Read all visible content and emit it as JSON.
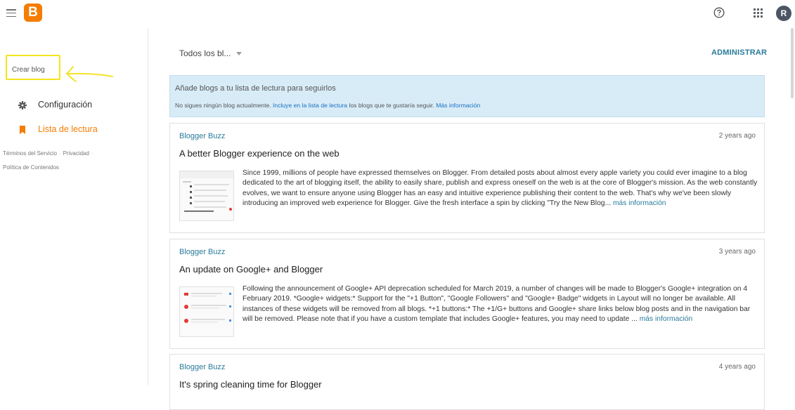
{
  "header": {
    "logo_letter": "B",
    "avatar_initial": "R",
    "brand_color": "#f57d00"
  },
  "sidebar": {
    "create_blog": "Crear blog",
    "nav": [
      {
        "label": "Configuración",
        "icon": "gear-icon"
      },
      {
        "label": "Lista de lectura",
        "icon": "bookmark-icon",
        "active": true
      }
    ],
    "footer": {
      "terms": "Términos del Servicio",
      "privacy": "Privacidad",
      "content_policy": "Política de Contenidos"
    }
  },
  "main": {
    "filter_label": "Todos los bl...",
    "admin_label": "ADMINISTRAR",
    "info": {
      "title": "Añade blogs a tu lista de lectura para seguirlos",
      "text_before": "No sigues ningún blog actualmente.",
      "link1": "Incluye en la lista de lectura",
      "text_middle": "los blogs que te gustaría seguir.",
      "link2": "Más información"
    },
    "posts": [
      {
        "source": "Blogger Buzz",
        "time": "2 years ago",
        "title": "A better Blogger experience on the web",
        "excerpt": "Since 1999, millions of people have expressed themselves on Blogger. From detailed posts about almost every apple variety you could ever imagine to a blog dedicated to the art of blogging itself, the ability to easily share, publish and express oneself on the web is at the core of Blogger's mission. As the web constantly evolves, we want to ensure anyone using Blogger has an easy and intuitive experience publishing their content to the web. That's why we've been slowly introducing an improved web experience for Blogger. Give the fresh interface a spin by clicking \"Try the New Blog...",
        "more": "más información"
      },
      {
        "source": "Blogger Buzz",
        "time": "3 years ago",
        "title": "An update on Google+ and Blogger",
        "excerpt": "Following the announcement of Google+ API deprecation scheduled for March 2019, a number of changes will be made to Blogger's Google+ integration on 4 February 2019. *Google+ widgets:* Support for the \"+1 Button\", \"Google Followers\" and \"Google+ Badge\" widgets in Layout will no longer be available. All instances of these widgets will be removed from all blogs. *+1 buttons:* The +1/G+ buttons and Google+ share links below blog posts and in the navigation bar will be removed. Please note that if you have a custom template that includes Google+ features, you may need to update ...",
        "more": "más información"
      },
      {
        "source": "Blogger Buzz",
        "time": "4 years ago",
        "title": "It's spring cleaning time for Blogger"
      }
    ]
  }
}
